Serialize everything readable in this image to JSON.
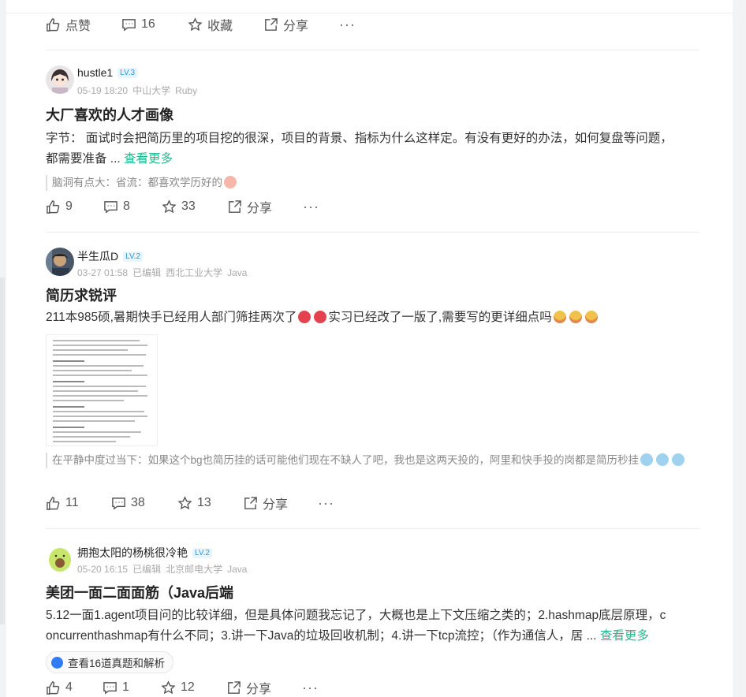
{
  "top_actions": {
    "like": "点赞",
    "comment": "16",
    "collect": "收藏",
    "share": "分享",
    "more": "···"
  },
  "posts": [
    {
      "user": "hustle1",
      "level": "LV.3",
      "date": "05-19 18:20",
      "edited": "",
      "school": "中山大学",
      "tag": "Ruby",
      "title": "大厂喜欢的人才画像",
      "body_line1": "字节：  面试时会把简历里的项目挖的很深，项目的背景、指标为什么这样定。有没有更好的办法，如何复盘等问题，",
      "body_line2": "都需要准备 ... ",
      "more": "查看更多",
      "comment": "脑洞有点大：省流：都喜欢学历好的",
      "likes": "9",
      "comments": "8",
      "stars": "33",
      "share": "分享",
      "more_dots": "···"
    },
    {
      "user": "半生瓜D",
      "level": "LV.2",
      "date": "03-27 01:58",
      "edited": "已编辑",
      "school": "西北工业大学",
      "tag": "Java",
      "title": "简历求锐评",
      "body_line1": "211本985硕,暑期快手已经用人部门筛挂两次了",
      "body_line1b": "实习已经改了一版了,需要写的更详细点吗",
      "comment": "在平静中度过当下：如果这个bg也简历挂的话可能他们现在不缺人了吧，我也是这两天投的，阿里和快手投的岗都是简历秒挂",
      "likes": "11",
      "comments": "38",
      "stars": "13",
      "share": "分享",
      "more_dots": "···"
    },
    {
      "user": "拥抱太阳的杨桃很冷艳",
      "level": "LV.2",
      "date": "05-20 16:15",
      "edited": "已编辑",
      "school": "北京邮电大学",
      "tag": "Java",
      "title": "美团一面二面面筋（Java后端",
      "body_line1": "5.12一面1.agent项目问的比较详细，但是具体问题我忘记了，大概也是上下文压缩之类的；2.hashmap底层原理，c",
      "body_line2": "oncurrenthashmap有什么不同；3.讲一下Java的垃圾回收机制；4.讲一下tcp流控；（作为通信人，居 ... ",
      "more": "查看更多",
      "chip": "查看16道真题和解析",
      "likes": "4",
      "comments": "1",
      "stars": "12",
      "share": "分享",
      "more_dots": "···"
    }
  ],
  "colors": {
    "accent": "#25b88c",
    "level_bg": "#e6f4fb",
    "level_fg": "#2b9ad9"
  }
}
